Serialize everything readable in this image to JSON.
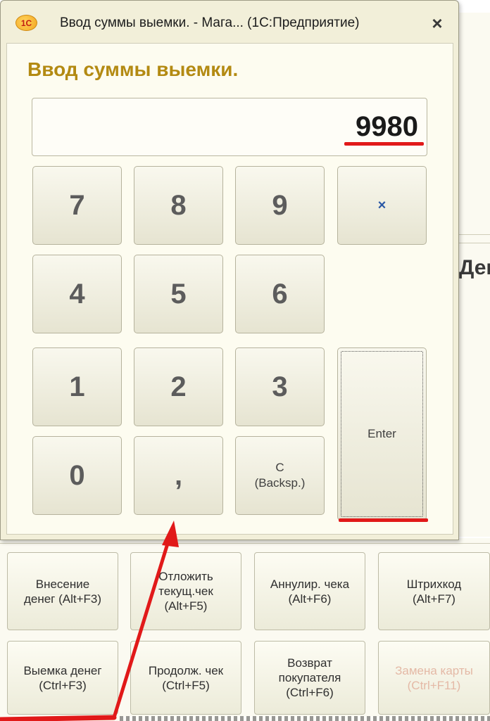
{
  "dialog": {
    "title": "Ввод суммы выемки. - Мага... (1С:Предприятие)",
    "logo_text": "1С",
    "close_glyph": "×",
    "heading": "Ввод суммы выемки.",
    "amount": "9980"
  },
  "keypad": {
    "k7": "7",
    "k8": "8",
    "k9": "9",
    "clear": "×",
    "k4": "4",
    "k5": "5",
    "k6": "6",
    "k1": "1",
    "k2": "2",
    "k3": "3",
    "enter": "Enter",
    "k0": "0",
    "comma": ",",
    "backspace": "C\n(Backsp.)"
  },
  "background": {
    "right_label": "Ден",
    "function_keys": [
      {
        "label": "Внесение\nденег (Alt+F3)"
      },
      {
        "label": "Отложить\nтекущ.чек\n(Alt+F5)"
      },
      {
        "label": "Аннулир. чека\n(Alt+F6)"
      },
      {
        "label": "Штрихкод\n(Alt+F7)"
      },
      {
        "label": "Выемка денег\n(Ctrl+F3)"
      },
      {
        "label": "Продолж. чек\n(Ctrl+F5)"
      },
      {
        "label": "Возврат\nпокупателя\n(Ctrl+F6)"
      },
      {
        "label": "Замена карты\n(Ctrl+F11)"
      }
    ]
  },
  "colors": {
    "heading": "#b38a12",
    "annotation": "#e11919",
    "disabled_text": "#e4b9a6"
  }
}
